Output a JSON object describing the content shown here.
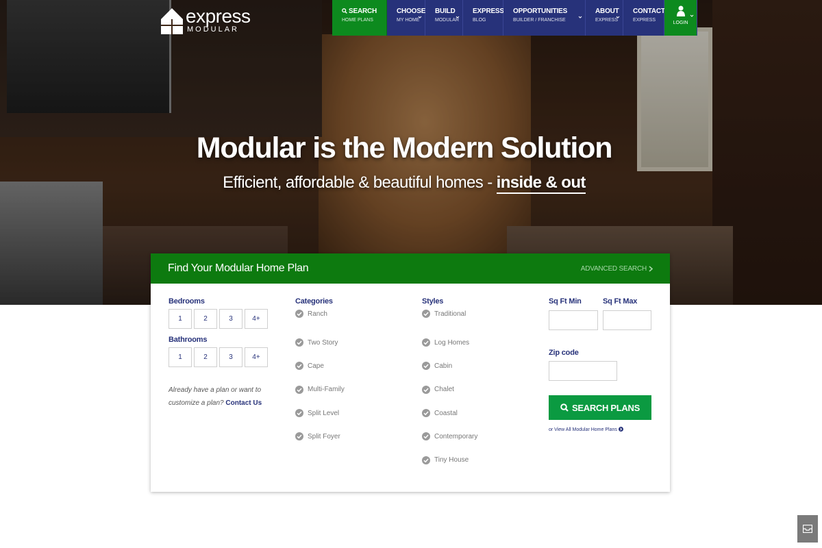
{
  "brand": {
    "logo_word": "express",
    "logo_sub": "MODULAR",
    "colors": {
      "nav_blue": "#27327a",
      "green": "#0d8a1e",
      "panel_green": "#0d7a0f",
      "button_green": "#0b9a41"
    }
  },
  "nav": {
    "items": [
      {
        "top": "SEARCH",
        "bottom": "HOME PLANS",
        "icon": "search-icon"
      },
      {
        "top": "CHOOSE",
        "bottom": "MY HOME"
      },
      {
        "top": "BUILD",
        "bottom": "MODULAR"
      },
      {
        "top": "EXPRESS",
        "bottom": "BLOG"
      },
      {
        "top": "OPPORTUNITIES",
        "bottom": "BUILDER / FRANCHISE"
      },
      {
        "top": "ABOUT",
        "bottom": "EXPRESS"
      },
      {
        "top": "CONTACT",
        "bottom": "EXPRESS"
      }
    ],
    "login": {
      "label": "LOGIN",
      "icon": "user-icon"
    }
  },
  "hero": {
    "headline": "Modular is the Modern Solution",
    "subline_pre": "Efficient, affordable & beautiful homes - ",
    "subline_highlight": "inside & out"
  },
  "search": {
    "title": "Find Your Modular Home Plan",
    "advanced": "ADVANCED SEARCH",
    "bedrooms": {
      "label": "Bedrooms",
      "options": [
        "1",
        "2",
        "3",
        "4+"
      ]
    },
    "bathrooms": {
      "label": "Bathrooms",
      "options": [
        "1",
        "2",
        "3",
        "4+"
      ]
    },
    "hint_pre": "Already have a plan or want to customize a plan?",
    "hint_link": "Contact Us",
    "categories": {
      "label": "Categories",
      "items": [
        "Ranch",
        "Two Story",
        "Cape",
        "Multi-Family",
        "Split Level",
        "Split Foyer"
      ]
    },
    "styles": {
      "label": "Styles",
      "items": [
        "Traditional",
        "Log Homes",
        "Cabin",
        "Chalet",
        "Coastal",
        "Contemporary",
        "Tiny House"
      ]
    },
    "sqft_min": {
      "label": "Sq Ft Min",
      "value": ""
    },
    "sqft_max": {
      "label": "Sq Ft Max",
      "value": ""
    },
    "zip": {
      "label": "Zip code",
      "value": ""
    },
    "button": "SEARCH PLANS",
    "view_all": "or View All Modular Home Plans"
  },
  "contact_widget": {
    "icon": "mail-icon"
  }
}
